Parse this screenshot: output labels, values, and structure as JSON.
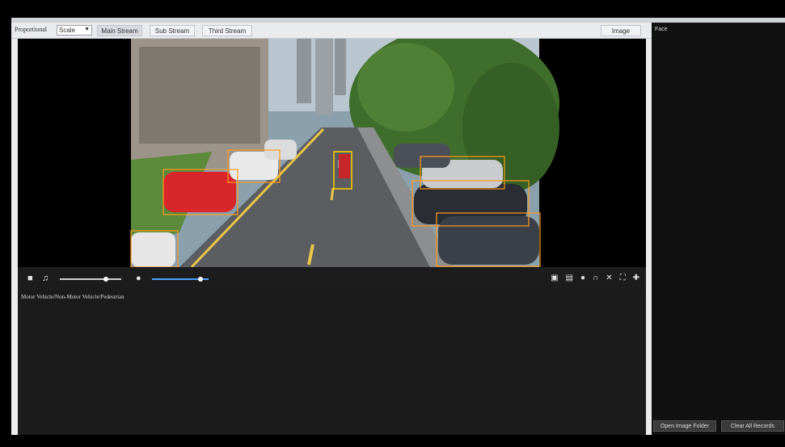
{
  "toolbar": {
    "ratio_label": "Proportional",
    "ratio_value": "Scale",
    "tabs": [
      "Main Stream",
      "Sub Stream",
      "Third Stream"
    ],
    "image_button": "Image"
  },
  "player": {
    "volume_level": 0.75,
    "mic_level": 0.85,
    "right_icons": [
      "snapshot-icon",
      "record-icon",
      "mic-icon",
      "headset-icon",
      "pdf-icon",
      "fullscreen-icon",
      "ptz-icon"
    ]
  },
  "detection": {
    "types_label": "Motor Vehicle/Non-Motor Vehicle/Pedestrian"
  },
  "right_panel": {
    "title": "Face",
    "open_folder_button": "Open Image Folder",
    "clear_button": "Clear All Records"
  },
  "colors": {
    "accent_blue": "#4aa3ff",
    "bbox_orange": "#ff9a1f",
    "bbox_yellow": "#ffd400"
  }
}
